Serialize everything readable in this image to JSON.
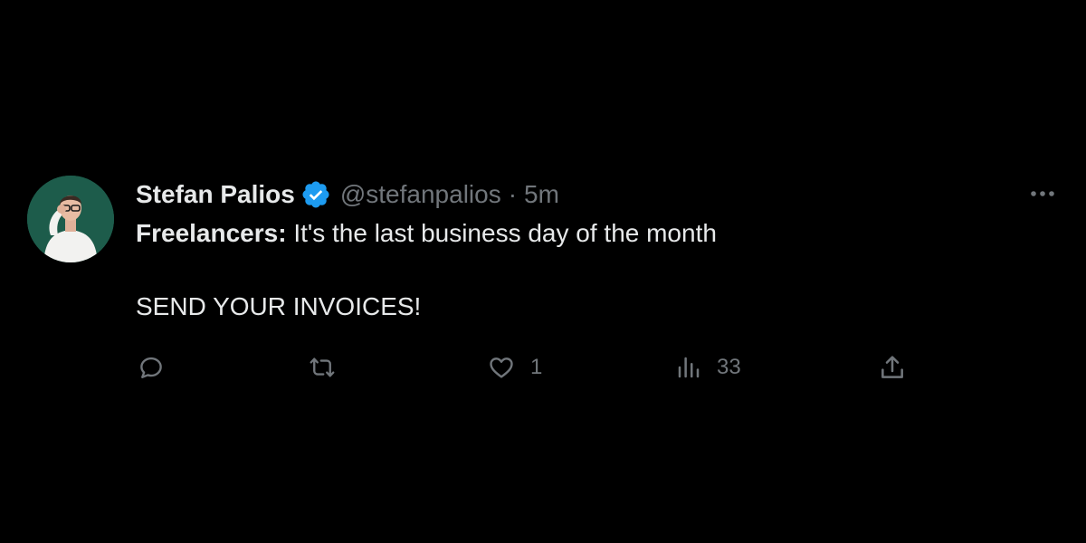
{
  "tweet": {
    "author": {
      "display_name": "Stefan Palios",
      "handle": "@stefanpalios",
      "verified": true,
      "verified_color": "#1d9bf0"
    },
    "separator": "·",
    "time": "5m",
    "text": {
      "bold_label": "Freelancers:",
      "line1_rest": " It's the last business day of the month",
      "line2": "SEND YOUR INVOICES!"
    },
    "actions": {
      "reply": {
        "icon": "reply-icon"
      },
      "retweet": {
        "icon": "retweet-icon"
      },
      "like": {
        "icon": "heart-icon",
        "count": "1"
      },
      "views": {
        "icon": "views-icon",
        "count": "33"
      },
      "share": {
        "icon": "share-icon"
      }
    },
    "more_icon": "more-options-icon"
  },
  "colors": {
    "background": "#000000",
    "primary_text": "#e7e9ea",
    "secondary_text": "#71767b"
  }
}
